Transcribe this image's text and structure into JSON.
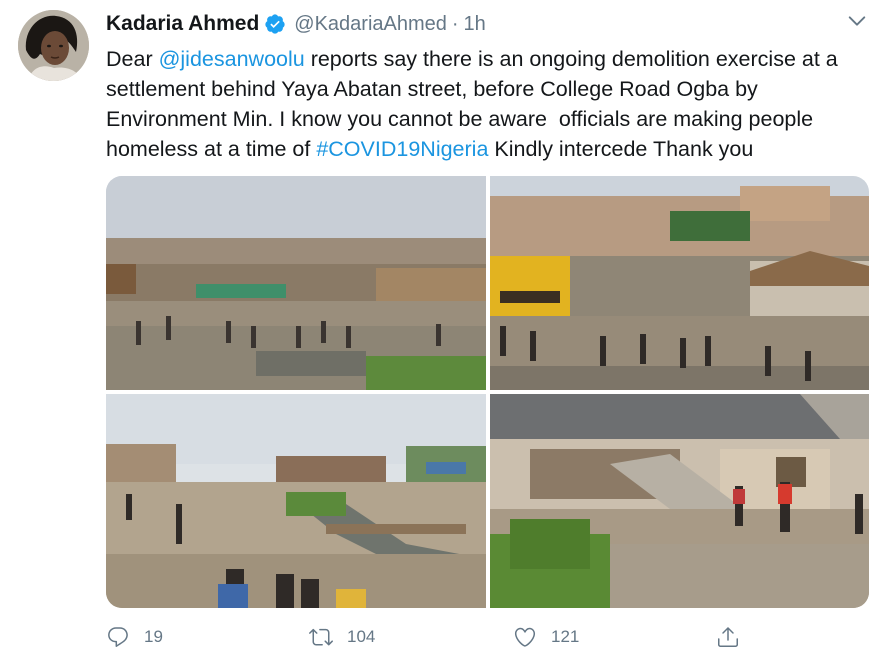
{
  "author": {
    "name": "Kadaria Ahmed",
    "handle": "@KadariaAhmed",
    "separator": "·",
    "time": "1h"
  },
  "tweet": {
    "parts": [
      {
        "text": "Dear ",
        "link": false
      },
      {
        "text": "@jidesanwoolu",
        "link": true
      },
      {
        "text": " reports say there is an ongoing demolition exercise at a settlement behind Yaya Abatan street, before College Road Ogba by Environment Min. I know you cannot be aware  officials are making people homeless at a time of ",
        "link": false
      },
      {
        "text": "#COVID19Nigeria",
        "link": true
      },
      {
        "text": " Kindly intercede Thank you",
        "link": false
      }
    ]
  },
  "media": {
    "photos": [
      {
        "description": "demolition-site-crowd"
      },
      {
        "description": "bulldozer-demolition"
      },
      {
        "description": "canal-settlement-rubble"
      },
      {
        "description": "collapsed-roof-houses"
      }
    ]
  },
  "actions": {
    "reply_count": "19",
    "retweet_count": "104",
    "like_count": "121"
  },
  "colors": {
    "link": "#1b95e0",
    "muted": "#657786",
    "verified": "#1da1f2"
  }
}
